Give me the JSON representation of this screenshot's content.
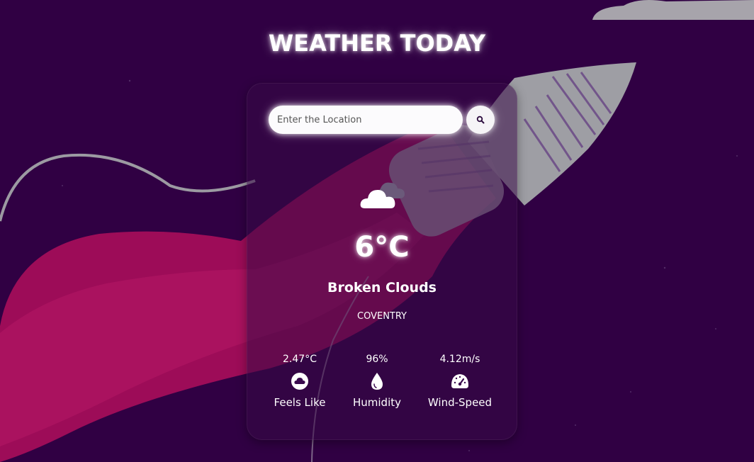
{
  "header": {
    "title": "WEATHER TODAY"
  },
  "search": {
    "placeholder": "Enter the Location",
    "value": "",
    "button_icon": "search-icon"
  },
  "current": {
    "icon": "broken-clouds-icon",
    "temperature": "6°C",
    "description": "Broken Clouds",
    "city": "COVENTRY"
  },
  "stats": [
    {
      "value": "2.47°C",
      "label": "Feels Like",
      "icon": "cloud-circle-icon"
    },
    {
      "value": "96%",
      "label": "Humidity",
      "icon": "droplet-icon"
    },
    {
      "value": "4.12m/s",
      "label": "Wind-Speed",
      "icon": "speedometer-icon"
    }
  ],
  "colors": {
    "background": "#300043",
    "trail": "#a10a5a",
    "rocket": "#9e9ea4",
    "text": "#ffffff"
  }
}
